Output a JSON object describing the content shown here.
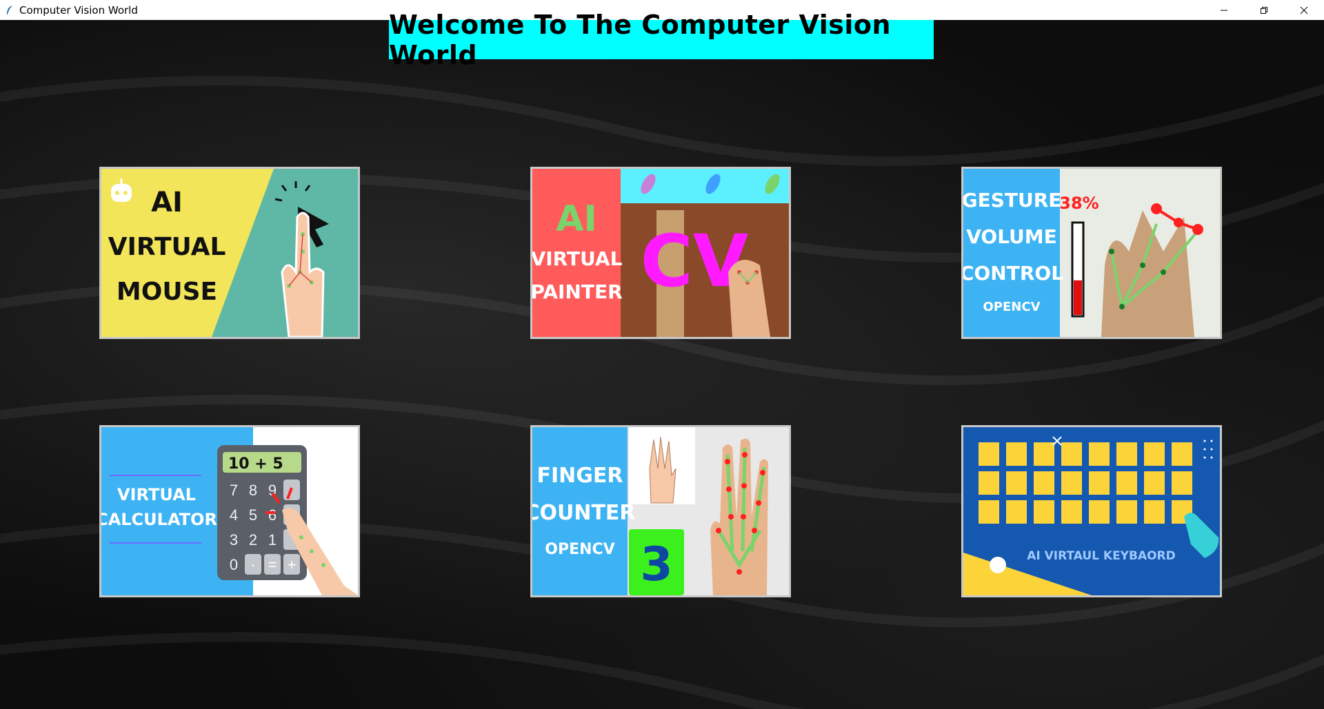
{
  "window": {
    "title": "Computer Vision World"
  },
  "header": {
    "title": "Welcome To The Computer Vision World"
  },
  "tiles": [
    {
      "lines": [
        "AI",
        "VIRTUAL",
        "MOUSE"
      ]
    },
    {
      "lines": [
        "AI",
        "VIRTUAL",
        "PAINTER"
      ],
      "overlay": "CV"
    },
    {
      "lines": [
        "GESTURE",
        "VOLUME",
        "CONTROL",
        "OPENCV"
      ],
      "percent": "38%",
      "level": 0.38
    },
    {
      "lines": [
        "VIRTUAL",
        "CALCULATOR"
      ],
      "display": "10 + 5",
      "keys": [
        "7",
        "8",
        "9",
        "4",
        "5",
        "6",
        "3",
        "2",
        "1",
        "0",
        "·",
        "=",
        "+"
      ]
    },
    {
      "lines": [
        "FINGER",
        "COUNTER",
        "OPENCV"
      ],
      "count": "3"
    },
    {
      "lines": [
        "AI VIRTAUL KEYBAORD"
      ]
    }
  ],
  "colors": {
    "header_bg": "#00ffff",
    "mouse_yellow": "#f2e55a",
    "mouse_teal": "#5fb7a6",
    "painter_red": "#ff5b5b",
    "blue": "#3db3f4",
    "keyboard_blue": "#1558b0",
    "key_yellow": "#fdd33a"
  }
}
